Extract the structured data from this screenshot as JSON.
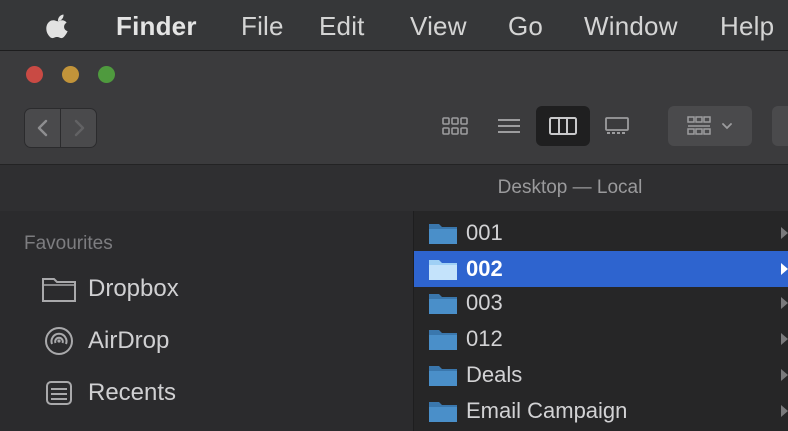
{
  "menubar": {
    "app_name": "Finder",
    "items": [
      "File",
      "Edit",
      "View",
      "Go",
      "Window",
      "Help"
    ]
  },
  "toolbar": {
    "traffic_lights": [
      "close",
      "minimize",
      "zoom"
    ],
    "nav": {
      "back_icon": "chevron-left-icon",
      "forward_icon": "chevron-right-icon"
    },
    "view_modes": [
      "icon-view",
      "list-view",
      "column-view",
      "gallery-view"
    ],
    "selected_view": "column-view",
    "group_icon": "group-by-icon"
  },
  "path_title": "Desktop — Local",
  "sidebar": {
    "section": "Favourites",
    "items": [
      {
        "label": "Dropbox",
        "icon": "dropbox-folder-icon"
      },
      {
        "label": "AirDrop",
        "icon": "airdrop-icon"
      },
      {
        "label": "Recents",
        "icon": "recents-icon"
      }
    ]
  },
  "column": {
    "items": [
      {
        "name": "001",
        "selected": false
      },
      {
        "name": "002",
        "selected": true
      },
      {
        "name": "003",
        "selected": false
      },
      {
        "name": "012",
        "selected": false
      },
      {
        "name": "Deals",
        "selected": false
      },
      {
        "name": "Email Campaign",
        "selected": false
      }
    ]
  },
  "colors": {
    "selection": "#2e64cf",
    "folder": "#3f86c4",
    "close": "#c94a44",
    "minimize": "#c2943a",
    "zoom": "#4f9a3e"
  }
}
